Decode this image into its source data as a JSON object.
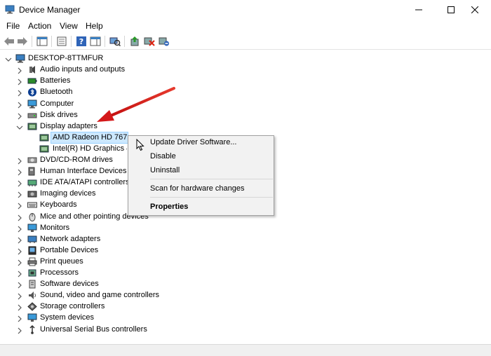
{
  "window": {
    "title": "Device Manager"
  },
  "menu": [
    "File",
    "Action",
    "View",
    "Help"
  ],
  "toolbar_icons": [
    "back-arrow-icon",
    "forward-arrow-icon",
    "show-hide-console-tree-icon",
    "properties-icon",
    "help-icon",
    "action-pane-icon",
    "scan-hardware-icon",
    "update-driver-icon",
    "uninstall-device-icon",
    "disable-device-icon"
  ],
  "tree": {
    "root": "DESKTOP-8TTMFUR",
    "categories": [
      "Audio inputs and outputs",
      "Batteries",
      "Bluetooth",
      "Computer",
      "Disk drives",
      "Display adapters",
      "DVD/CD-ROM drives",
      "Human Interface Devices",
      "IDE ATA/ATAPI controllers",
      "Imaging devices",
      "Keyboards",
      "Mice and other pointing devices",
      "Monitors",
      "Network adapters",
      "Portable Devices",
      "Print queues",
      "Processors",
      "Software devices",
      "Sound, video and game controllers",
      "Storage controllers",
      "System devices",
      "Universal Serial Bus controllers"
    ],
    "display_adapters": [
      "AMD Radeon HD 7670M",
      "Intel(R) HD Graphics 4000"
    ]
  },
  "context_menu": {
    "update": "Update Driver Software...",
    "disable": "Disable",
    "uninstall": "Uninstall",
    "scan": "Scan for hardware changes",
    "properties": "Properties"
  },
  "colors": {
    "selection": "#cce8ff",
    "arrow": "#e0201b"
  }
}
